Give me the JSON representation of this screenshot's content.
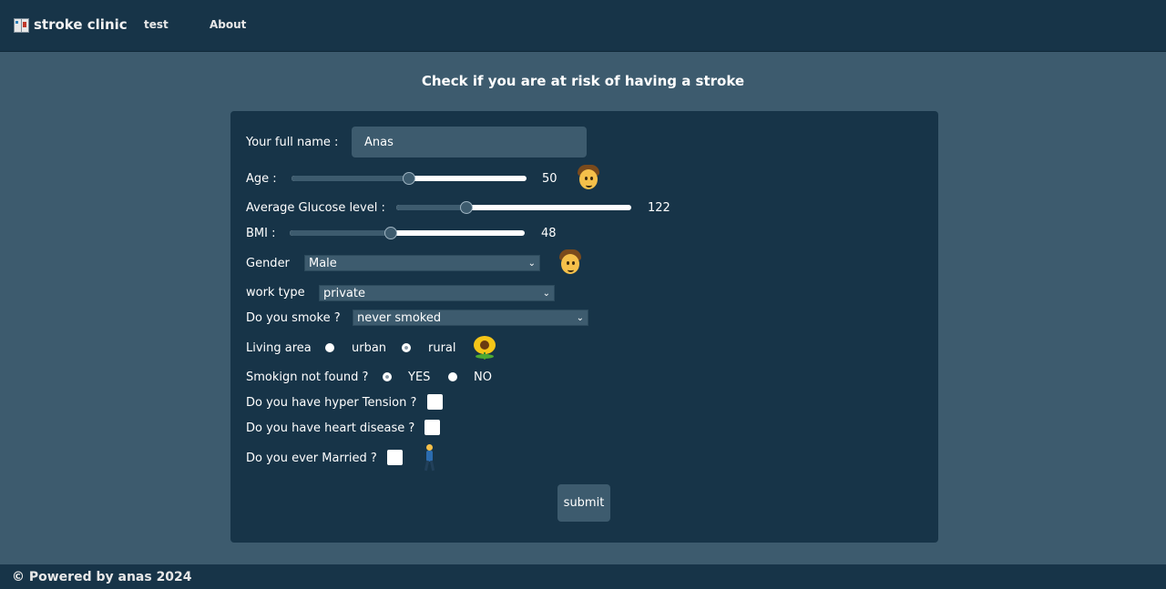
{
  "nav": {
    "brand": "stroke clinic",
    "brand_icon": "clinic-icon",
    "links": [
      "test",
      "About"
    ]
  },
  "heading": "Check if you are at risk of having a stroke",
  "form": {
    "name_label": "Your full name :",
    "name_value": "Anas",
    "age_label": "Age :",
    "age_value": "50",
    "age_fraction": 0.5,
    "glucose_label": "Average Glucose level :",
    "glucose_value": "122",
    "glucose_fraction": 0.3,
    "bmi_label": "BMI :",
    "bmi_value": "48",
    "bmi_fraction": 0.43,
    "gender_label": "Gender",
    "gender_value": "Male",
    "work_label": "work type",
    "work_value": "private",
    "smoke_label": "Do you smoke ?",
    "smoke_value": "never smoked",
    "living_label": "Living area",
    "living_options": [
      "urban",
      "rural"
    ],
    "living_selected": "rural",
    "smoking_nf_label": "Smokign not found ?",
    "smoking_nf_options": [
      "YES",
      "NO"
    ],
    "smoking_nf_selected": "YES",
    "hypertension_label": "Do you have hyper Tension ?",
    "heart_label": "Do you have heart disease ?",
    "married_label": "Do you ever Married ?",
    "submit_label": "submit"
  },
  "footer": "© Powered by anas 2024",
  "colors": {
    "nav_bg": "#173448",
    "page_bg": "#3d5b6e",
    "card_bg": "#173448",
    "input_bg": "#3d5b6e"
  }
}
